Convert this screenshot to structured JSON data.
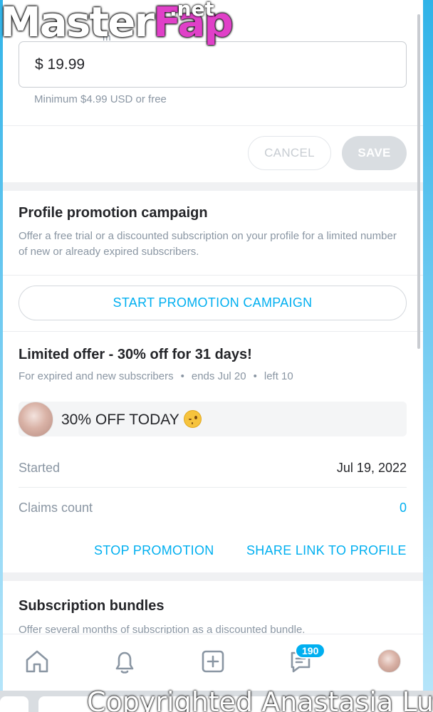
{
  "price": {
    "field_label_partial": "m",
    "value": "$ 19.99",
    "hint": "Minimum $4.99 USD or free",
    "cancel_label": "CANCEL",
    "save_label": "SAVE"
  },
  "promotion": {
    "title": "Profile promotion campaign",
    "description": "Offer a free trial or a discounted subscription on your profile for a limited number of new or already expired subscribers.",
    "start_label": "START PROMOTION CAMPAIGN"
  },
  "offer": {
    "title": "Limited offer - 30% off for 31 days!",
    "audience": "For expired and new subscribers",
    "ends": "ends Jul 20",
    "left": "left 10",
    "separator": "•",
    "message": "30% OFF TODAY",
    "emoji": "winking-face",
    "started_label": "Started",
    "started_value": "Jul 19, 2022",
    "claims_label": "Claims count",
    "claims_value": "0",
    "stop_label": "STOP PROMOTION",
    "share_label": "SHARE LINK TO PROFILE"
  },
  "bundles": {
    "title": "Subscription bundles",
    "description": "Offer several months of subscription as a discounted bundle."
  },
  "nav": {
    "items": [
      "home-icon",
      "bell-icon",
      "add-post-icon",
      "messages-icon",
      "profile-avatar"
    ],
    "messages_badge": "190"
  },
  "watermarks": {
    "logo_main": "Master",
    "logo_accent": "Fap",
    "logo_suffix": ".net",
    "copyright": "Copyrighted Anastasia Lux"
  },
  "colors": {
    "accent": "#00aff0",
    "muted_text": "#8a96a3",
    "text": "#242529",
    "background": "#f0f1f3"
  }
}
